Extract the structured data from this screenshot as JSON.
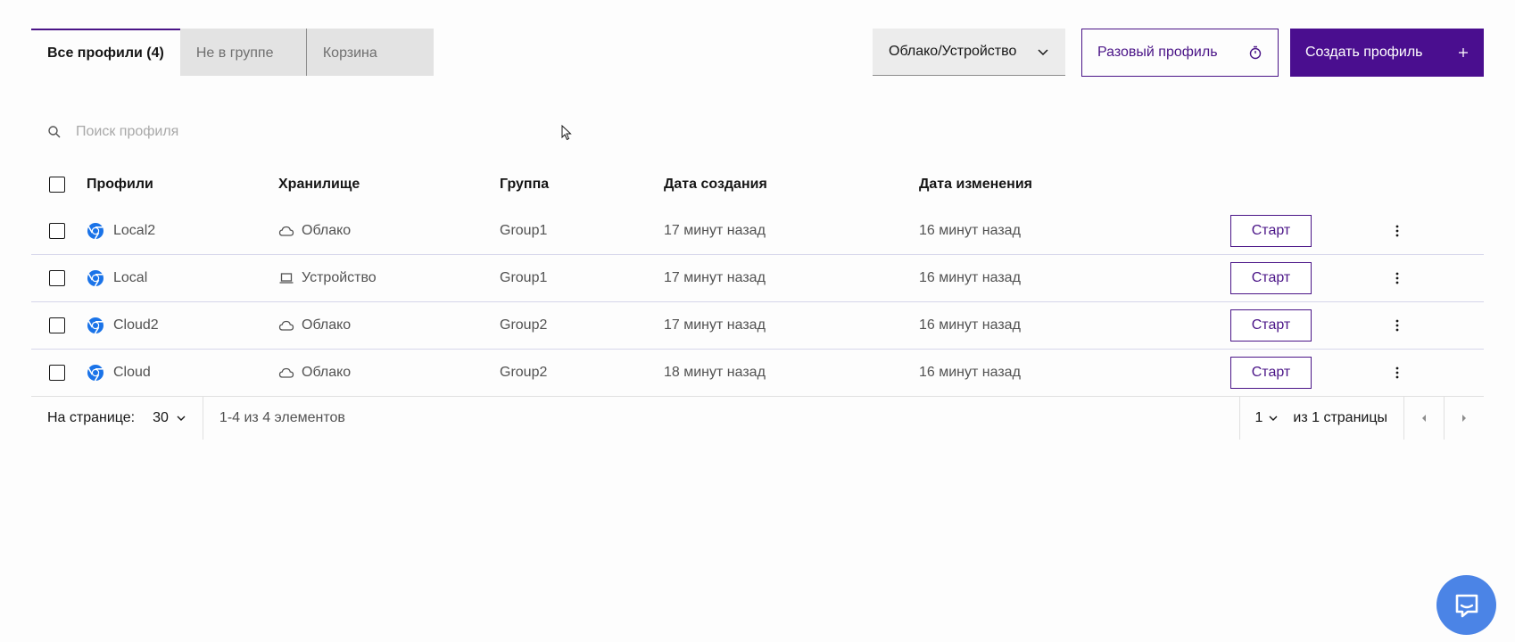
{
  "tabs": [
    {
      "label": "Все профили (4)",
      "active": true
    },
    {
      "label": "Не в группе",
      "active": false
    },
    {
      "label": "Корзина",
      "active": false
    }
  ],
  "toolbar": {
    "storage_filter": "Облако/Устройство",
    "one_time_profile": "Разовый профиль",
    "create_profile": "Создать профиль"
  },
  "search": {
    "placeholder": "Поиск профиля"
  },
  "table": {
    "headers": {
      "profiles": "Профили",
      "storage": "Хранилище",
      "group": "Группа",
      "created": "Дата создания",
      "changed": "Дата изменения"
    },
    "start_label": "Старт",
    "rows": [
      {
        "name": "Local2",
        "storage": "Облако",
        "storage_icon": "cloud-icon",
        "group": "Group1",
        "created": "17 минут назад",
        "changed": "16 минут назад"
      },
      {
        "name": "Local",
        "storage": "Устройство",
        "storage_icon": "laptop-icon",
        "group": "Group1",
        "created": "17 минут назад",
        "changed": "16 минут назад"
      },
      {
        "name": "Cloud2",
        "storage": "Облако",
        "storage_icon": "cloud-icon",
        "group": "Group2",
        "created": "17 минут назад",
        "changed": "16 минут назад"
      },
      {
        "name": "Cloud",
        "storage": "Облако",
        "storage_icon": "cloud-icon",
        "group": "Group2",
        "created": "18 минут назад",
        "changed": "16 минут назад"
      }
    ]
  },
  "pagination": {
    "per_page_label": "На странице:",
    "per_page": "30",
    "range": "1-4 из 4 элементов",
    "page": "1",
    "of_pages": "из 1 страницы"
  },
  "colors": {
    "accent": "#4a0e8f",
    "help_button": "#4b84e6"
  }
}
